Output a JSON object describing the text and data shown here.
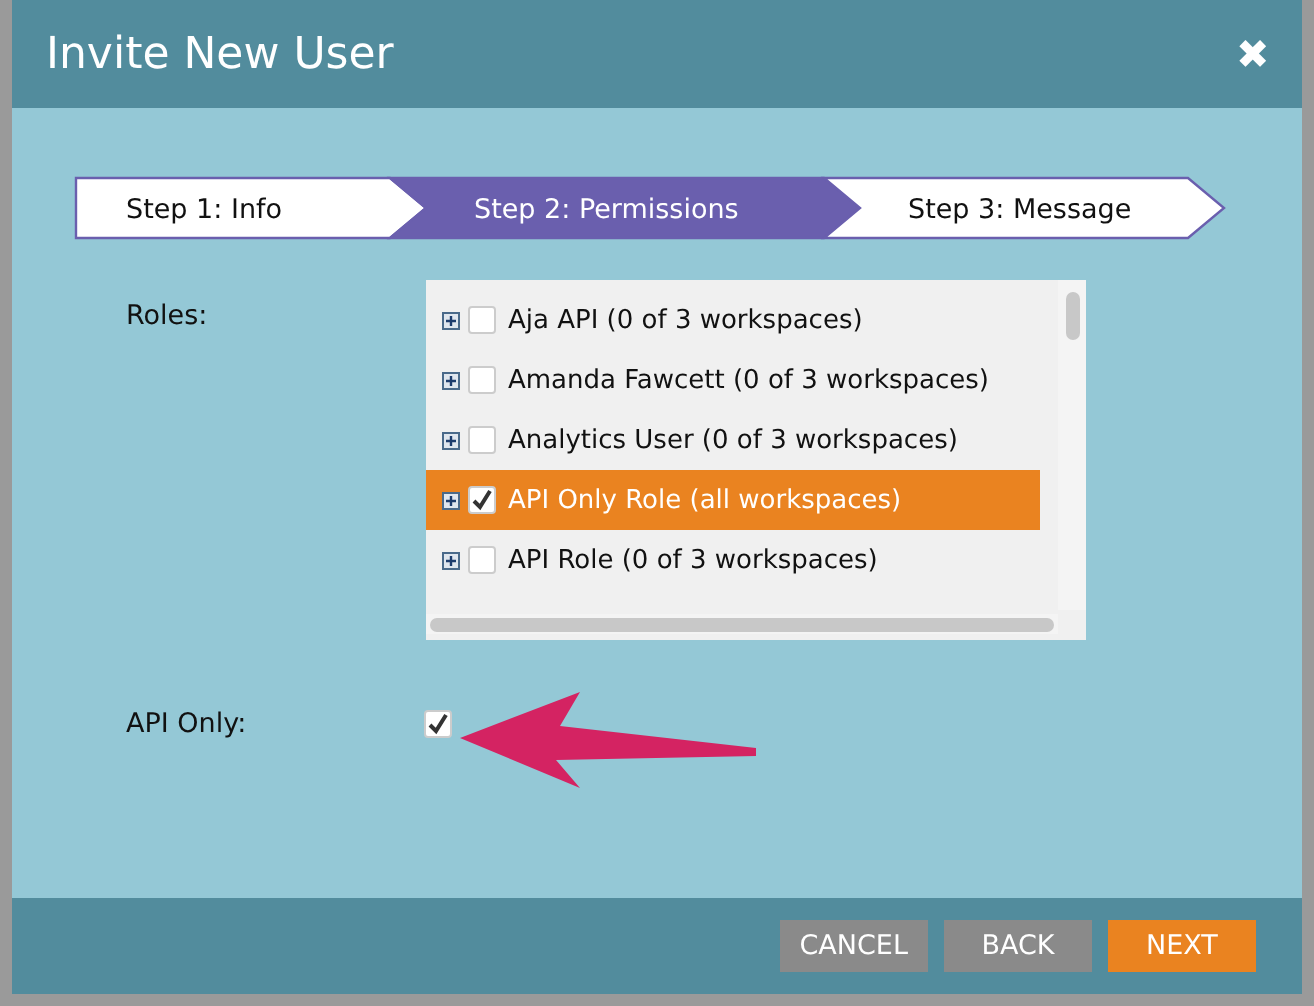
{
  "dialog": {
    "title": "Invite New User",
    "close": "✖"
  },
  "steps": [
    {
      "label": "Step 1: Info",
      "selected": false
    },
    {
      "label": "Step 2: Permissions",
      "selected": true
    },
    {
      "label": "Step 3: Message",
      "selected": false
    }
  ],
  "roles": {
    "label": "Roles:",
    "items": [
      {
        "label": "Aja API (0 of 3 workspaces)",
        "checked": false,
        "selected": false
      },
      {
        "label": "Amanda Fawcett (0 of 3 workspaces)",
        "checked": false,
        "selected": false
      },
      {
        "label": "Analytics User (0 of 3 workspaces)",
        "checked": false,
        "selected": false
      },
      {
        "label": "API Only Role (all workspaces)",
        "checked": true,
        "selected": true
      },
      {
        "label": "API Role (0 of 3 workspaces)",
        "checked": false,
        "selected": false
      }
    ]
  },
  "api_only": {
    "label": "API Only:",
    "checked": true
  },
  "buttons": [
    {
      "label": "CANCEL",
      "kind": "secondary"
    },
    {
      "label": "BACK",
      "kind": "secondary"
    },
    {
      "label": "NEXT",
      "kind": "primary"
    }
  ]
}
